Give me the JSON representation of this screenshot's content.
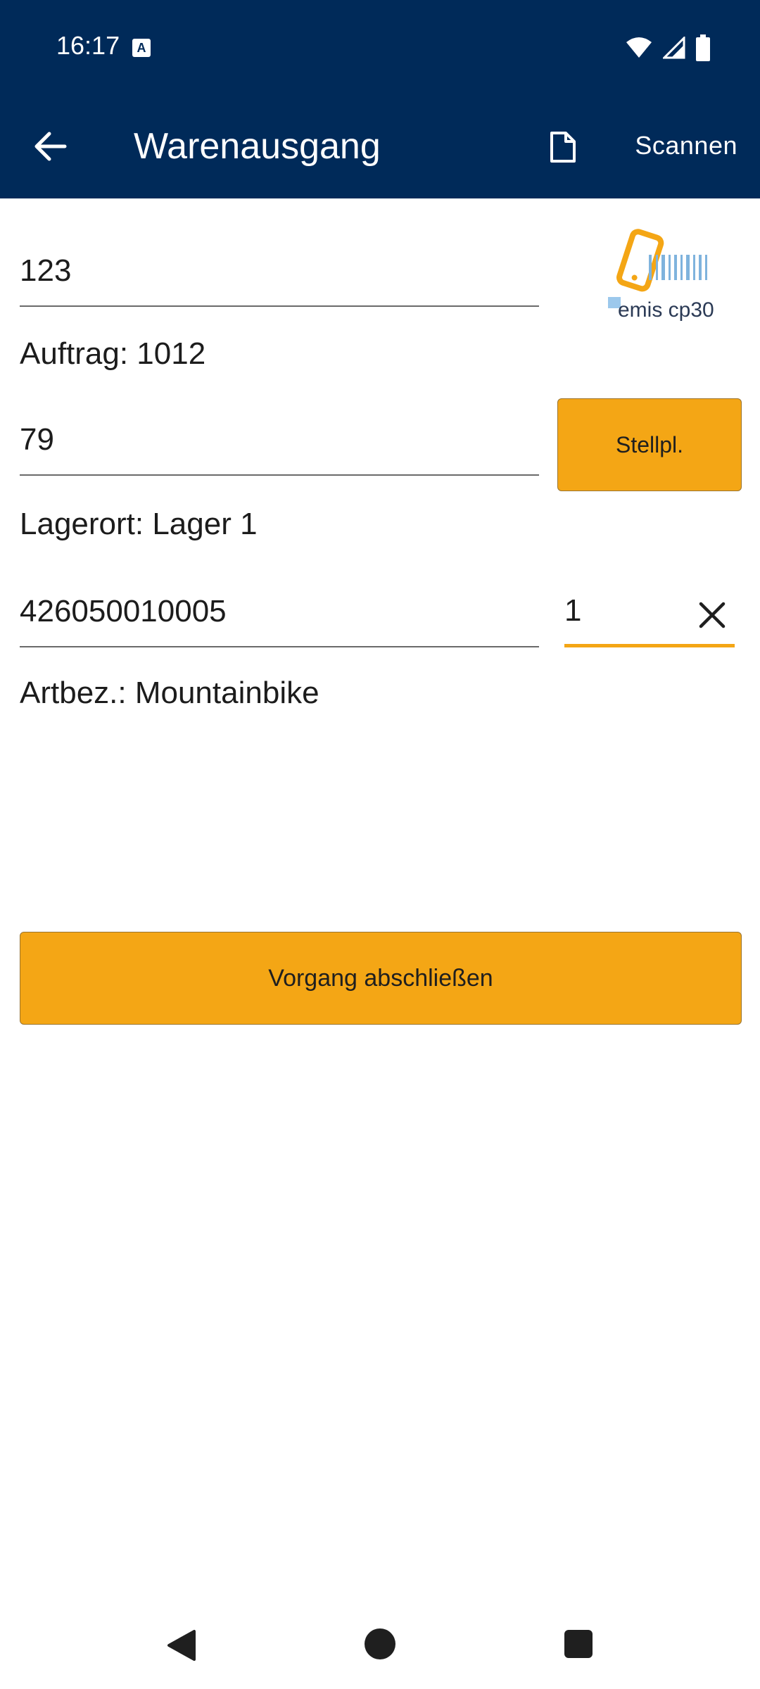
{
  "status_bar": {
    "time": "16:17"
  },
  "app_bar": {
    "title": "Warenausgang",
    "scan_label": "Scannen"
  },
  "form": {
    "order_number": "123",
    "order_info": "Auftrag: 1012",
    "location_code": "79",
    "location_button": "Stellpl.",
    "location_info": "Lagerort: Lager 1",
    "article_code": "426050010005",
    "quantity": "1",
    "article_info": "Artbez.: Mountainbike",
    "finish_button": "Vorgang abschließen"
  },
  "logo": {
    "text": "emis cp30"
  },
  "colors": {
    "primary": "#002a59",
    "accent": "#f4a615"
  }
}
